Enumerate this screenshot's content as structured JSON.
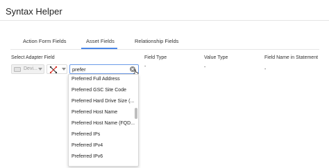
{
  "header": {
    "title": "Syntax Helper"
  },
  "tabs": [
    {
      "label": "Action Form Fields"
    },
    {
      "label": "Asset Fields"
    },
    {
      "label": "Relationship Fields"
    }
  ],
  "active_tab": "Asset Fields",
  "columns": {
    "adapter_field": "Select Adapter Field",
    "field_type": "Field Type",
    "value_type": "Value Type",
    "field_name": "Field Name in Statement"
  },
  "values": {
    "field_type": "-",
    "value_type": "-",
    "field_name": "-"
  },
  "adapter_select": {
    "value": "Devi..."
  },
  "search": {
    "value": "prefer"
  },
  "dropdown": {
    "items": [
      "Preferred Full Address",
      "Preferred GSC Site Code",
      "Preferred Hard Drive Size (...",
      "Preferred Host Name",
      "Preferred Host Name (FQD...",
      "Preferred IPs",
      "Preferred IPv4",
      "Preferred IPv6"
    ]
  },
  "colors": {
    "accent": "#4a86e8",
    "input_border": "#6a9ae8",
    "op_icon_red": "#d93025"
  },
  "icons": {
    "adapter": "device-icon",
    "operator": "cross-arrows-icon",
    "clear": "clear-icon",
    "cursor": "mouse-cursor-icon"
  }
}
